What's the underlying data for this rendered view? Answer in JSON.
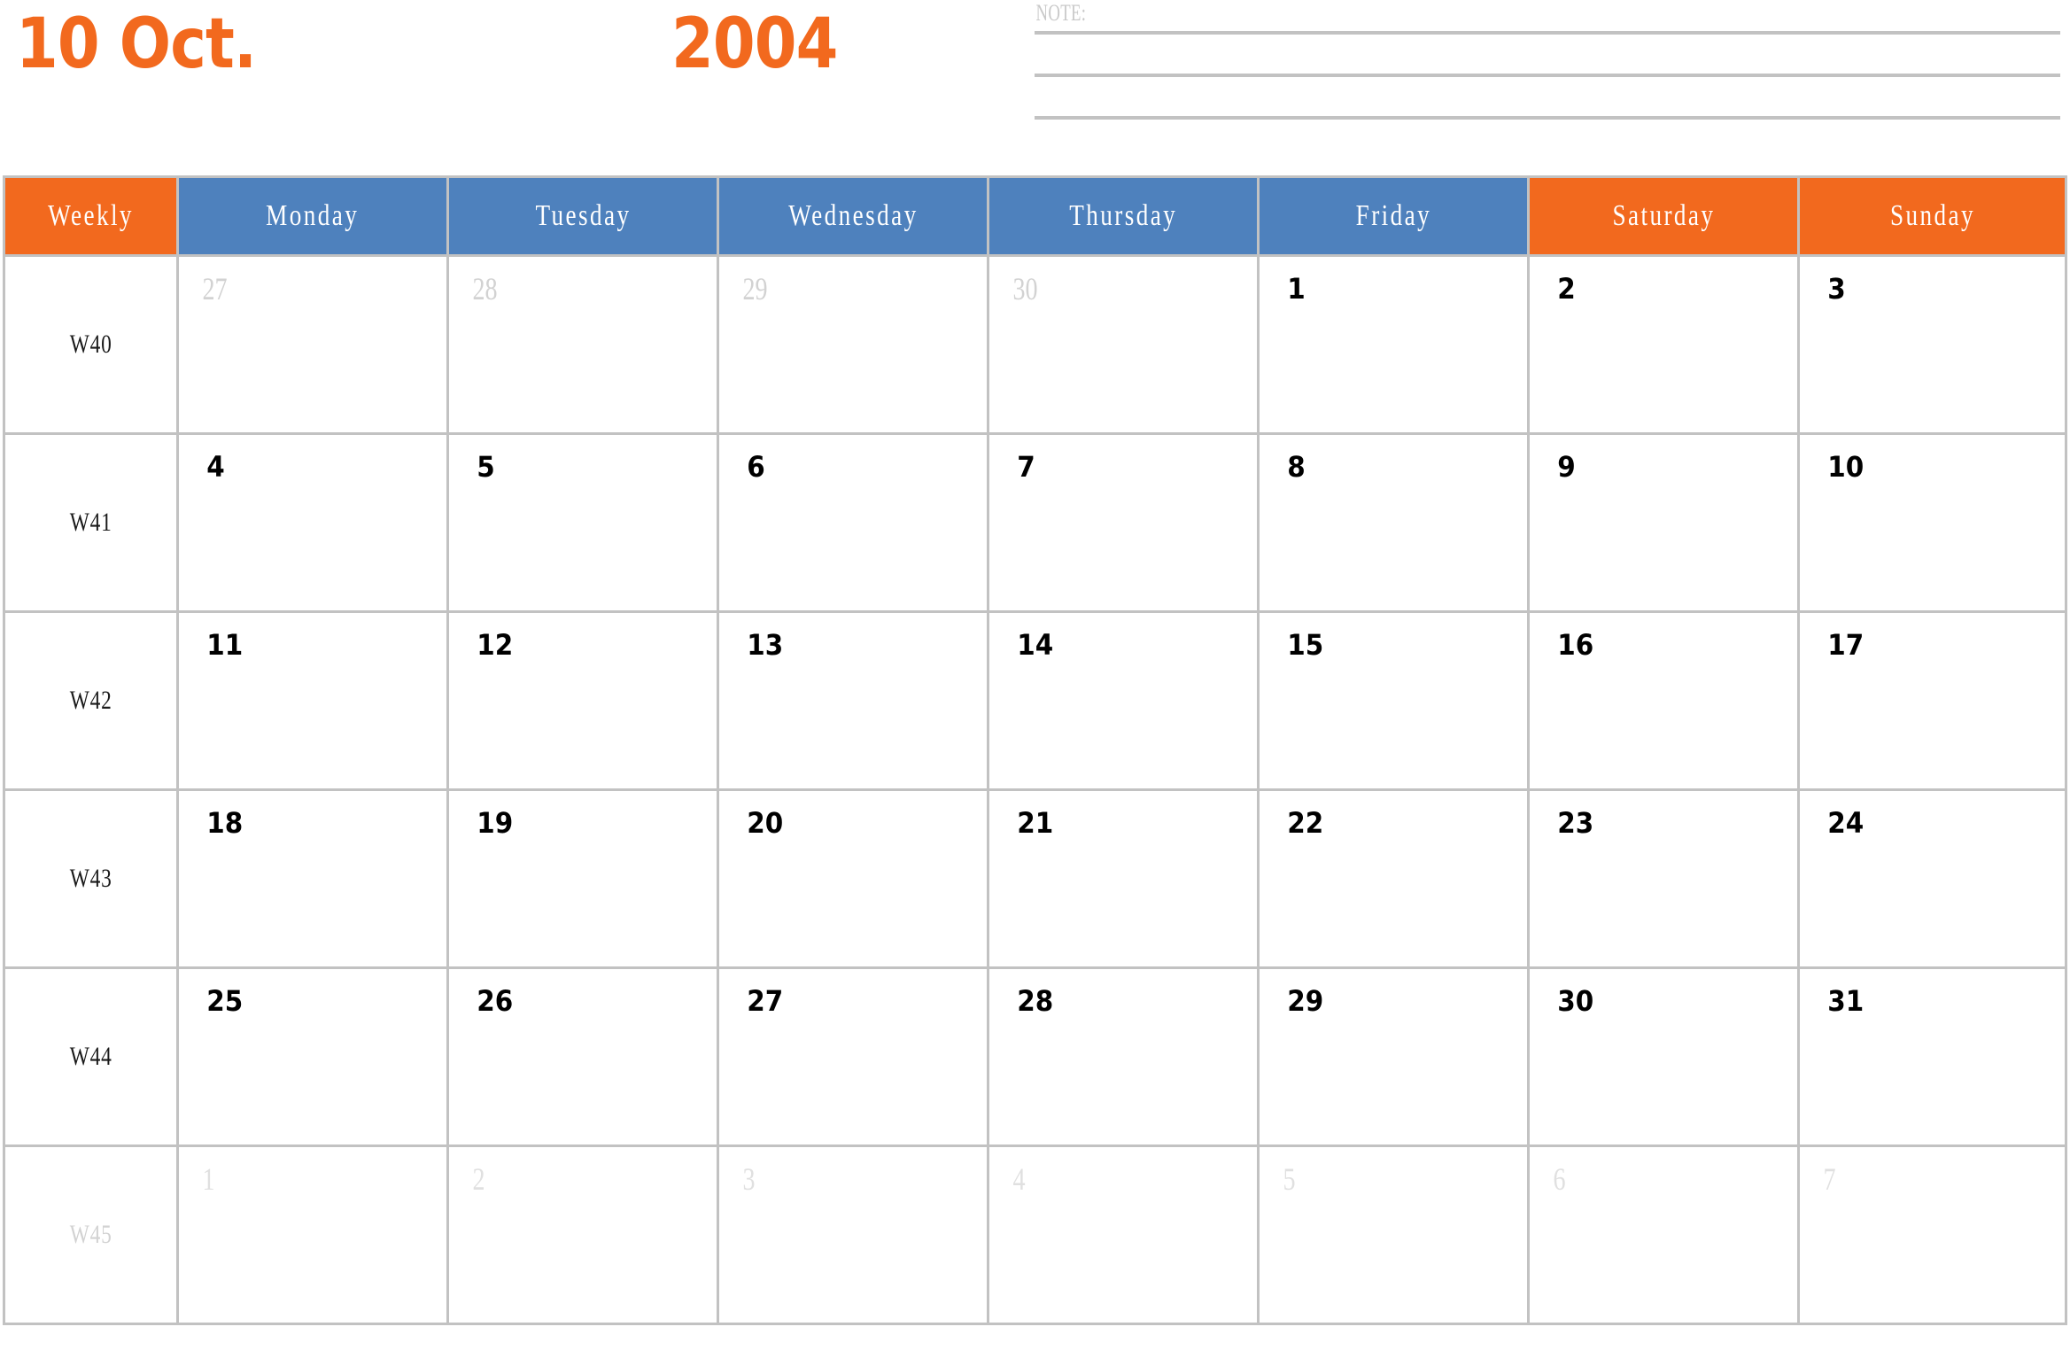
{
  "header": {
    "month_label": "10 Oct.",
    "year_label": "2004",
    "note_label": "NOTE:",
    "note_line_count": 3
  },
  "colors": {
    "accent_orange": "#F2691E",
    "accent_blue": "#4E81BD",
    "grid_gray": "#C2C2C2",
    "muted_text": "#D2D2D2",
    "active_text": "#000000"
  },
  "calendar": {
    "columns": [
      {
        "label": "Weekly",
        "style": "weekly"
      },
      {
        "label": "Monday",
        "style": "weekday"
      },
      {
        "label": "Tuesday",
        "style": "weekday"
      },
      {
        "label": "Wednesday",
        "style": "weekday"
      },
      {
        "label": "Thursday",
        "style": "weekday"
      },
      {
        "label": "Friday",
        "style": "weekday"
      },
      {
        "label": "Saturday",
        "style": "weekend"
      },
      {
        "label": "Sunday",
        "style": "weekend"
      }
    ],
    "rows": [
      {
        "week": "W40",
        "week_muted": false,
        "days": [
          {
            "num": "27",
            "state": "muted"
          },
          {
            "num": "28",
            "state": "muted"
          },
          {
            "num": "29",
            "state": "muted"
          },
          {
            "num": "30",
            "state": "muted"
          },
          {
            "num": "1",
            "state": "active"
          },
          {
            "num": "2",
            "state": "active"
          },
          {
            "num": "3",
            "state": "active"
          }
        ]
      },
      {
        "week": "W41",
        "week_muted": false,
        "days": [
          {
            "num": "4",
            "state": "active"
          },
          {
            "num": "5",
            "state": "active"
          },
          {
            "num": "6",
            "state": "active"
          },
          {
            "num": "7",
            "state": "active"
          },
          {
            "num": "8",
            "state": "active"
          },
          {
            "num": "9",
            "state": "active"
          },
          {
            "num": "10",
            "state": "active"
          }
        ]
      },
      {
        "week": "W42",
        "week_muted": false,
        "days": [
          {
            "num": "11",
            "state": "active"
          },
          {
            "num": "12",
            "state": "active"
          },
          {
            "num": "13",
            "state": "active"
          },
          {
            "num": "14",
            "state": "active"
          },
          {
            "num": "15",
            "state": "active"
          },
          {
            "num": "16",
            "state": "active"
          },
          {
            "num": "17",
            "state": "active"
          }
        ]
      },
      {
        "week": "W43",
        "week_muted": false,
        "days": [
          {
            "num": "18",
            "state": "active"
          },
          {
            "num": "19",
            "state": "active"
          },
          {
            "num": "20",
            "state": "active"
          },
          {
            "num": "21",
            "state": "active"
          },
          {
            "num": "22",
            "state": "active"
          },
          {
            "num": "23",
            "state": "active"
          },
          {
            "num": "24",
            "state": "active"
          }
        ]
      },
      {
        "week": "W44",
        "week_muted": false,
        "days": [
          {
            "num": "25",
            "state": "active"
          },
          {
            "num": "26",
            "state": "active"
          },
          {
            "num": "27",
            "state": "active"
          },
          {
            "num": "28",
            "state": "active"
          },
          {
            "num": "29",
            "state": "active"
          },
          {
            "num": "30",
            "state": "active"
          },
          {
            "num": "31",
            "state": "active"
          }
        ]
      },
      {
        "week": "W45",
        "week_muted": true,
        "days": [
          {
            "num": "1",
            "state": "muted-light"
          },
          {
            "num": "2",
            "state": "muted-light"
          },
          {
            "num": "3",
            "state": "muted-light"
          },
          {
            "num": "4",
            "state": "muted-light"
          },
          {
            "num": "5",
            "state": "muted-light"
          },
          {
            "num": "6",
            "state": "muted-light"
          },
          {
            "num": "7",
            "state": "muted-light"
          }
        ]
      }
    ]
  }
}
